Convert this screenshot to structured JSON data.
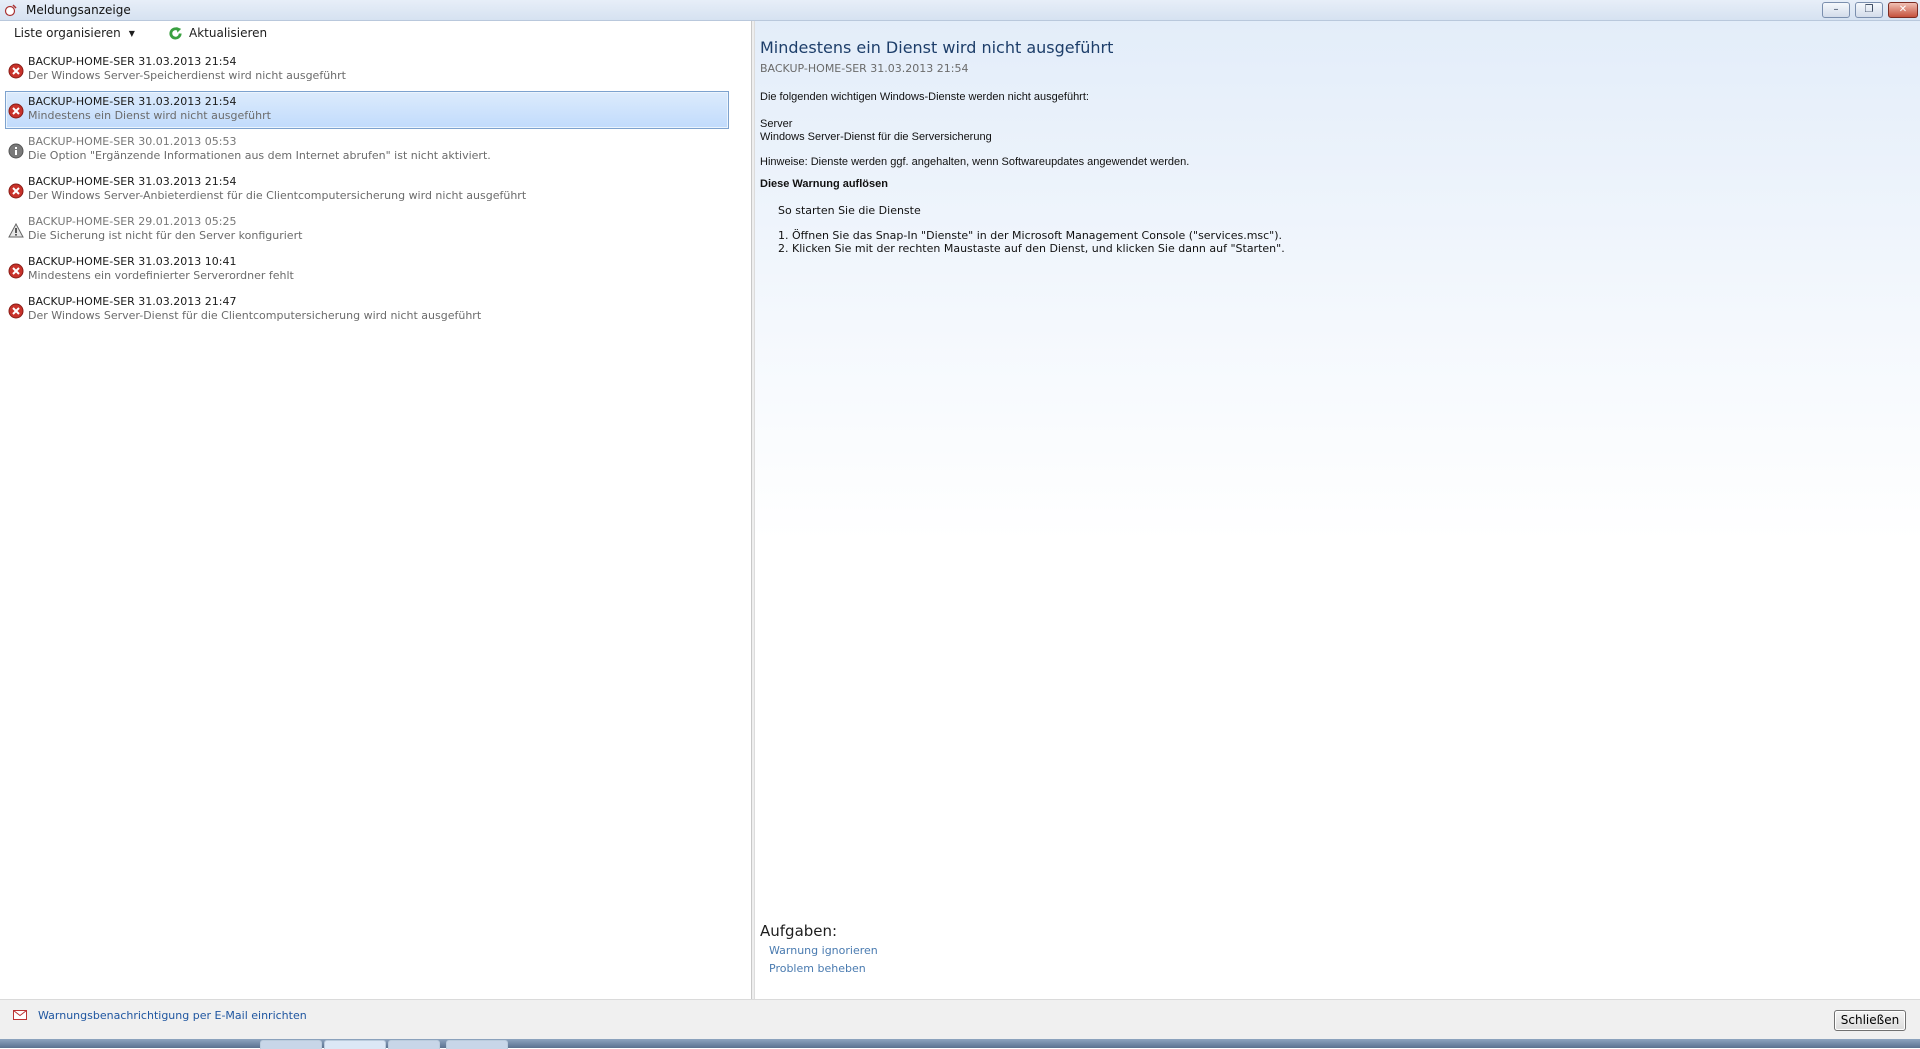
{
  "window": {
    "title": "Meldungsanzeige",
    "buttons": {
      "minimize": "–",
      "maximize": "❐",
      "close": "✕"
    }
  },
  "toolbar": {
    "organize_label": "Liste organisieren",
    "refresh_label": "Aktualisieren"
  },
  "messages": [
    {
      "icon": "error-icon",
      "header": "BACKUP-HOME-SER 31.03.2013 21:54",
      "text": "Der Windows Server-Speicherdienst wird nicht ausgeführt"
    },
    {
      "icon": "error-icon",
      "header": "BACKUP-HOME-SER 31.03.2013 21:54",
      "text": "Mindestens ein Dienst wird nicht ausgeführt",
      "selected": true
    },
    {
      "icon": "info-icon",
      "header": "BACKUP-HOME-SER 30.01.2013 05:53",
      "text": "Die Option \"Ergänzende Informationen aus dem Internet abrufen\" ist nicht aktiviert.",
      "muted": true
    },
    {
      "icon": "error-icon",
      "header": "BACKUP-HOME-SER 31.03.2013 21:54",
      "text": "Der Windows Server-Anbieterdienst für die Clientcomputersicherung wird nicht ausgeführt"
    },
    {
      "icon": "warning-icon",
      "header": "BACKUP-HOME-SER 29.01.2013 05:25",
      "text": "Die Sicherung ist nicht für den Server konfiguriert",
      "muted": true
    },
    {
      "icon": "error-icon",
      "header": "BACKUP-HOME-SER 31.03.2013 10:41",
      "text": "Mindestens ein vordefinierter Serverordner fehlt"
    },
    {
      "icon": "error-icon",
      "header": "BACKUP-HOME-SER 31.03.2013 21:47",
      "text": "Der Windows Server-Dienst für die Clientcomputersicherung wird nicht ausgeführt"
    }
  ],
  "detail": {
    "title": "Mindestens ein Dienst wird nicht ausgeführt",
    "meta": "BACKUP-HOME-SER 31.03.2013 21:54",
    "intro": "Die folgenden wichtigen Windows-Dienste werden nicht ausgeführt:",
    "service_1": "Server",
    "service_2": "Windows Server-Dienst für die Serversicherung",
    "hint": "Hinweise: Dienste werden ggf. angehalten, wenn Softwareupdates angewendet werden.",
    "resolve_title": "Diese Warnung auflösen",
    "steps_intro": "So starten Sie die Dienste",
    "step_1": "1. Öffnen Sie das Snap-In \"Dienste\" in der Microsoft Management Console (\"services.msc\").",
    "step_2": "2. Klicken Sie mit der rechten Maustaste auf den Dienst, und klicken Sie dann auf \"Starten\".",
    "tasks_title": "Aufgaben:",
    "task_ignore": "Warnung ignorieren",
    "task_fix": "Problem beheben"
  },
  "footer": {
    "email_link": "Warnungsbenachrichtigung per E-Mail einrichten",
    "close_button": "Schließen"
  },
  "colors": {
    "error": "#c8322a",
    "info": "#6e6e6e",
    "warning": "#7a7a7a",
    "link": "#4a7bb0",
    "title_blue": "#1d3e6a",
    "selection": "#c1dbfc"
  }
}
